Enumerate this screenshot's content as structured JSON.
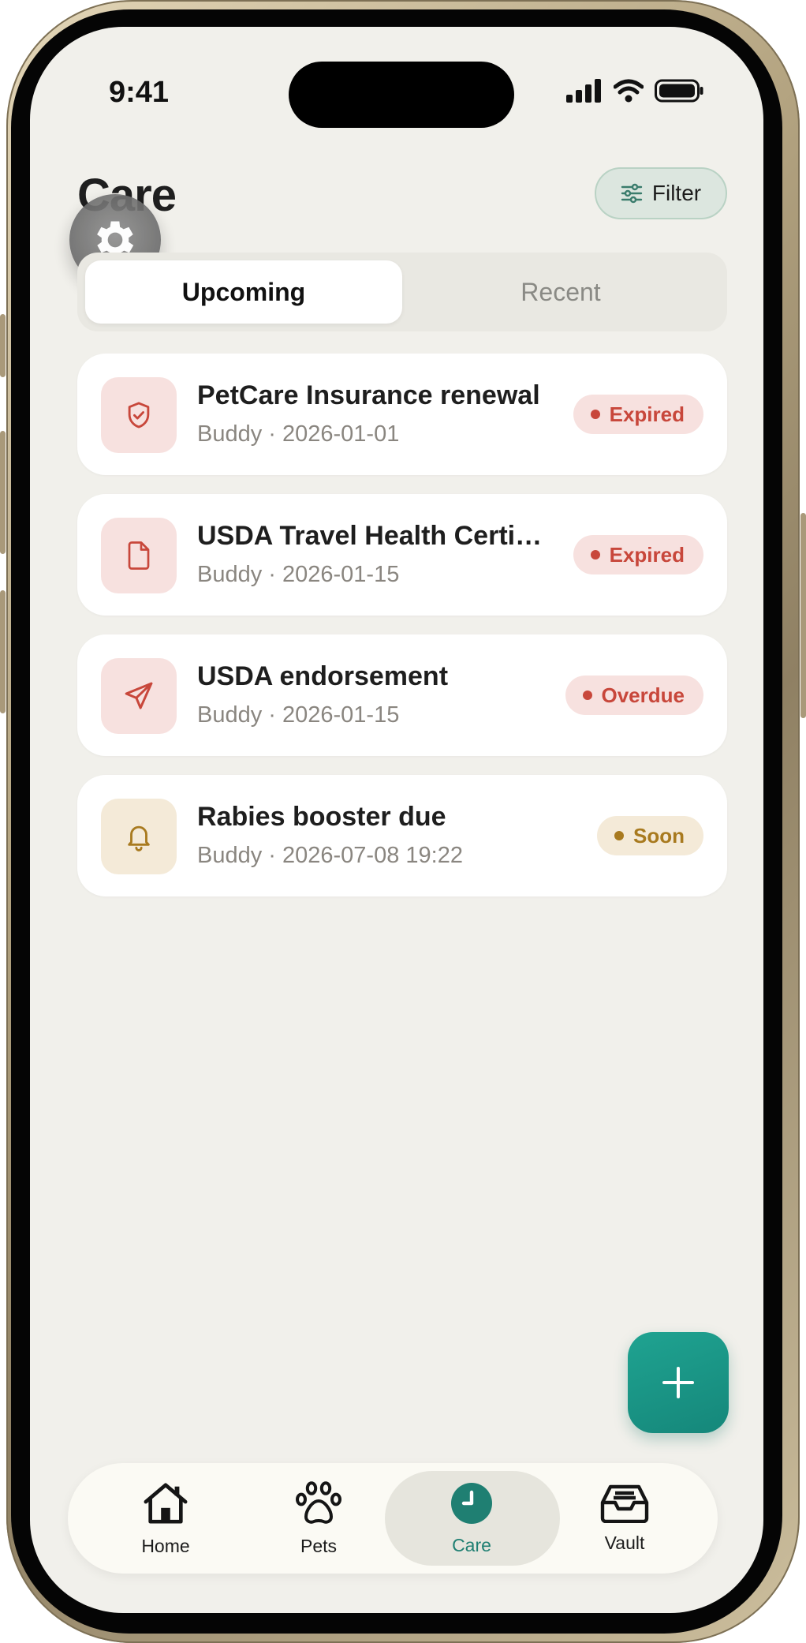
{
  "status_bar": {
    "time": "9:41"
  },
  "header": {
    "title": "Care",
    "filter_label": "Filter"
  },
  "segments": {
    "upcoming": "Upcoming",
    "recent": "Recent"
  },
  "items": [
    {
      "title": "PetCare Insurance renewal",
      "subtitle": "Buddy · 2026-01-01",
      "status": "Expired",
      "icon": "shield-check-icon",
      "tone": "red"
    },
    {
      "title": "USDA Travel Health Certi…",
      "subtitle": "Buddy · 2026-01-15",
      "status": "Expired",
      "icon": "document-icon",
      "tone": "red"
    },
    {
      "title": "USDA endorsement",
      "subtitle": "Buddy · 2026-01-15",
      "status": "Overdue",
      "icon": "send-icon",
      "tone": "red"
    },
    {
      "title": "Rabies booster due",
      "subtitle": "Buddy · 2026-07-08 19:22",
      "status": "Soon",
      "icon": "bell-icon",
      "tone": "gold"
    }
  ],
  "tabbar": [
    {
      "label": "Home",
      "icon": "home-icon"
    },
    {
      "label": "Pets",
      "icon": "paw-icon"
    },
    {
      "label": "Care",
      "icon": "clock-icon",
      "active": true
    },
    {
      "label": "Vault",
      "icon": "inbox-icon"
    }
  ],
  "colors": {
    "accent": "#1a9585",
    "danger": "#c8473b",
    "warning": "#a87a1f",
    "background": "#f1f0eb"
  }
}
